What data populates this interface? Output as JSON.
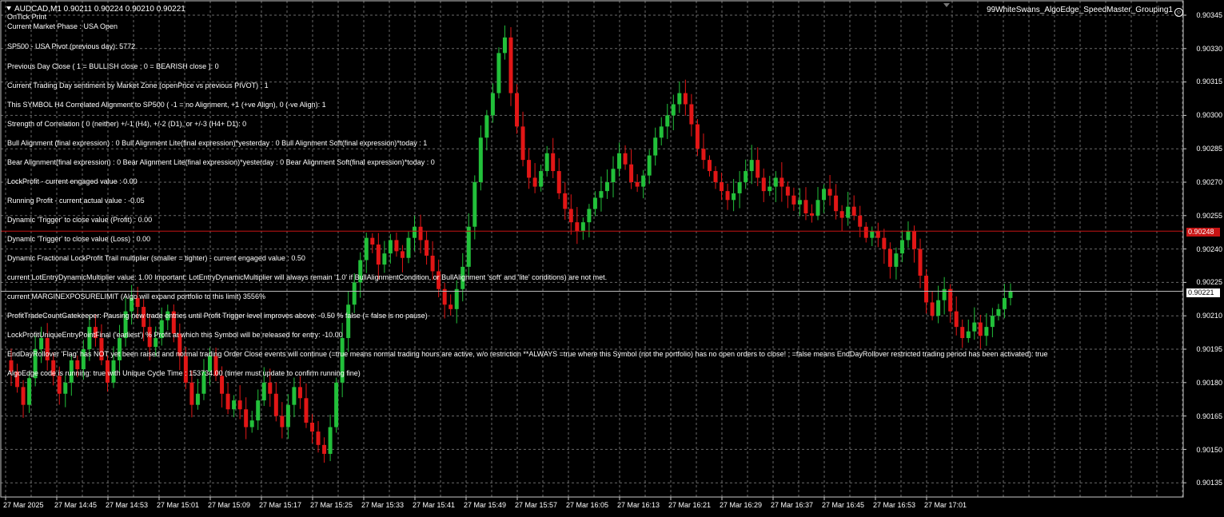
{
  "header": {
    "symbol_line": "AUDCAD,M1  0.90211 0.90224 0.90210 0.90221",
    "ea_name": "99WhiteSwans_AlgoEdge_SpeedMaster_Grouping1"
  },
  "info_lines": [
    "OnTick Print",
    "Current Market Phase : USA Open",
    "SP500 - USA Pivot (previous day): 5772",
    "Previous Day Close ( 1 = BULLISH close ; 0 = BEARISH close ): 0",
    "Current Trading Day sentiment by Market Zone (openPrice vs previous PIVOT) : 1",
    "This SYMBOL H4 Correlated Alignment to SP500 ( -1 = no Alignment, +1 (+ve Align), 0 (-ve Align):  1",
    "Strength of Correlation ( 0 (neither) +/-1 (H4), +/-2 (D1), or +/-3 (H4+ D1): 0",
    "Bull Alignment (final expression) : 0   Bull Alignment Lite(final expression)*yesterday : 0   Bull Alignment Soft(final expression)*today : 1",
    "Bear Alignment(final expression) : 0   Bear Alignment Lite(final expression)*yesterday : 0   Bear Alignment Soft(final expression)*today : 0",
    "LockProfit - current engaged value : 0.00",
    "Running Profit - current actual value : -0.05",
    "Dynamic 'Trigger' to close value (Profit) : 0.00",
    "Dynamic 'Trigger' to close value (Loss) : 0.00",
    "Dynamic Fractional LockProfit Trail multiplier (smaller = tighter) - current engaged value : 0.50",
    "current LotEntryDynamicMultiplier value: 1.00  Important: LotEntryDynamicMultiplier will always remain '1.0' if BullAlignmentCondition, or BullAlignment 'soft' and 'lite' conditions) are not met.",
    "current MARGINEXPOSURELIMIT (Algo will expand portfolio to this limit) 3556%",
    "ProfitTradeCountGatekeeper: Pausing new trade entries until Profit Trigger level improves above: -0.50 % false (= false is no pause)",
    "LockProfitUniqueEntryPointFinal ('earliest') % Profit at which this Symbol will be released for entry: -10.00",
    "EndDayRollover 'Flag' has NOT yet been raised and normal trading Order Close events will continue (=true means normal trading hours are active, w/o restriction **ALWAYS =true where this Symbol (not the portfolio) has no open orders to close! ; =false means EndDayRollover restricted trading period has been activated): true",
    "AlgoEdge code is running: true with Unique Cycle Time : 153734.00 (timer must update to confirm running fine)"
  ],
  "price_axis": [
    "0.90345",
    "0.90330",
    "0.90315",
    "0.90300",
    "0.90285",
    "0.90270",
    "0.90255",
    "0.90240",
    "0.90225",
    "0.90210",
    "0.90195",
    "0.90180",
    "0.90165",
    "0.90150",
    "0.90135"
  ],
  "time_axis": [
    "27 Mar 2025",
    "27 Mar 14:45",
    "27 Mar 14:53",
    "27 Mar 15:01",
    "27 Mar 15:09",
    "27 Mar 15:17",
    "27 Mar 15:25",
    "27 Mar 15:33",
    "27 Mar 15:41",
    "27 Mar 15:49",
    "27 Mar 15:57",
    "27 Mar 16:05",
    "27 Mar 16:13",
    "27 Mar 16:21",
    "27 Mar 16:29",
    "27 Mar 16:37",
    "27 Mar 16:45",
    "27 Mar 16:53",
    "27 Mar 17:01"
  ],
  "levels": {
    "red_line_price": "0.90248",
    "current_price": "0.90221"
  },
  "colors": {
    "bull": "#22c03a",
    "bear": "#e21616",
    "grid": "#6a6a6a",
    "level_red": "#c81414",
    "bid_line": "#bbbbbb",
    "background": "#000000"
  },
  "chart_data": {
    "type": "candlestick",
    "symbol": "AUDCAD",
    "timeframe": "M1",
    "ylim": [
      0.9013,
      0.9035
    ],
    "path": [
      0.9019,
      0.90185,
      0.90178,
      0.9017,
      0.90182,
      0.90195,
      0.902,
      0.9019,
      0.90183,
      0.90175,
      0.9018,
      0.9019,
      0.90186,
      0.90195,
      0.90205,
      0.902,
      0.9019,
      0.9018,
      0.9019,
      0.902,
      0.90212,
      0.90218,
      0.90214,
      0.90205,
      0.90196,
      0.902,
      0.90208,
      0.90212,
      0.90202,
      0.90192,
      0.9018,
      0.9017,
      0.90175,
      0.90185,
      0.90192,
      0.90183,
      0.90175,
      0.90168,
      0.90172,
      0.90168,
      0.9016,
      0.90163,
      0.90172,
      0.9018,
      0.90175,
      0.90165,
      0.9016,
      0.9017,
      0.90178,
      0.90173,
      0.90162,
      0.90158,
      0.90152,
      0.90148,
      0.9016,
      0.9018,
      0.902,
      0.90215,
      0.90225,
      0.90235,
      0.90245,
      0.90242,
      0.90233,
      0.90238,
      0.90244,
      0.90239,
      0.90236,
      0.90245,
      0.9025,
      0.90244,
      0.90237,
      0.9023,
      0.90222,
      0.90215,
      0.90213,
      0.90222,
      0.90232,
      0.9025,
      0.9027,
      0.9029,
      0.903,
      0.9031,
      0.90328,
      0.90335,
      0.9031,
      0.90295,
      0.9028,
      0.90272,
      0.90268,
      0.90275,
      0.90283,
      0.90275,
      0.90265,
      0.90258,
      0.90252,
      0.90248,
      0.90252,
      0.90258,
      0.90263,
      0.90266,
      0.9027,
      0.90276,
      0.90283,
      0.90278,
      0.9027,
      0.90268,
      0.90273,
      0.90282,
      0.9029,
      0.90295,
      0.903,
      0.90305,
      0.9031,
      0.90305,
      0.90296,
      0.90285,
      0.9028,
      0.90275,
      0.9027,
      0.90266,
      0.90262,
      0.90265,
      0.9027,
      0.90275,
      0.9028,
      0.90272,
      0.90266,
      0.90268,
      0.90272,
      0.90268,
      0.90264,
      0.9026,
      0.90262,
      0.90256,
      0.90255,
      0.90262,
      0.90267,
      0.90264,
      0.90257,
      0.90254,
      0.90259,
      0.90255,
      0.9025,
      0.90245,
      0.90248,
      0.90245,
      0.9024,
      0.90232,
      0.90238,
      0.90244,
      0.90248,
      0.9024,
      0.90228,
      0.90216,
      0.9021,
      0.90217,
      0.90222,
      0.90212,
      0.90205,
      0.902,
      0.90203,
      0.90207,
      0.90201,
      0.90205,
      0.9021,
      0.90213,
      0.90218,
      0.90221
    ]
  }
}
